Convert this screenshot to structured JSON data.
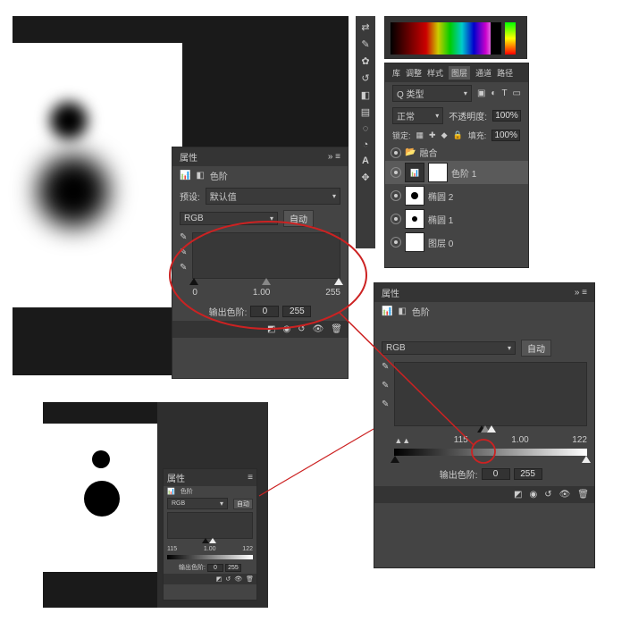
{
  "canvas_top": {},
  "canvas_bottom": {},
  "tabs_right": {
    "lib": "库",
    "adjust": "调整",
    "style": "样式",
    "layers": "图层",
    "channels": "通道",
    "paths": "路径"
  },
  "layers": {
    "kind_label": "Q 类型",
    "blend": "正常",
    "opacity_label": "不透明度:",
    "opacity_value": "100%",
    "lock_label": "锁定:",
    "fill_label": "填充:",
    "fill_value": "100%",
    "group": "融合",
    "items": [
      {
        "name": "色阶 1"
      },
      {
        "name": "椭圆 2"
      },
      {
        "name": "椭圆 1"
      },
      {
        "name": "图层 0"
      }
    ]
  },
  "panel1": {
    "title": "属性",
    "adj_name": "色阶",
    "preset_label": "预设:",
    "preset_value": "默认值",
    "channel": "RGB",
    "auto": "自动",
    "in_black": "0",
    "in_gamma": "1.00",
    "in_white": "255",
    "out_label": "输出色阶:",
    "out_black": "0",
    "out_white": "255"
  },
  "panel2": {
    "title": "属性",
    "adj_name": "色阶",
    "channel": "RGB",
    "auto": "自动",
    "in_black": "115",
    "in_gamma": "1.00",
    "in_white": "122",
    "out_label": "输出色阶:",
    "out_black": "0",
    "out_white": "255"
  },
  "mini_panel": {
    "title": "属性",
    "adj_name": "色阶",
    "channel": "RGB",
    "auto": "自动",
    "in_black": "115",
    "in_gamma": "1.00",
    "in_white": "122",
    "out_label": "输出色阶:",
    "out_black": "0",
    "out_white": "255"
  },
  "colors": {
    "panel_bg": "#444444",
    "ellipse_color": "#cc2222"
  },
  "chart_data": {
    "type": "other",
    "note": "Levels adjustment histogram (values not rendered as numeric series in UI)."
  }
}
